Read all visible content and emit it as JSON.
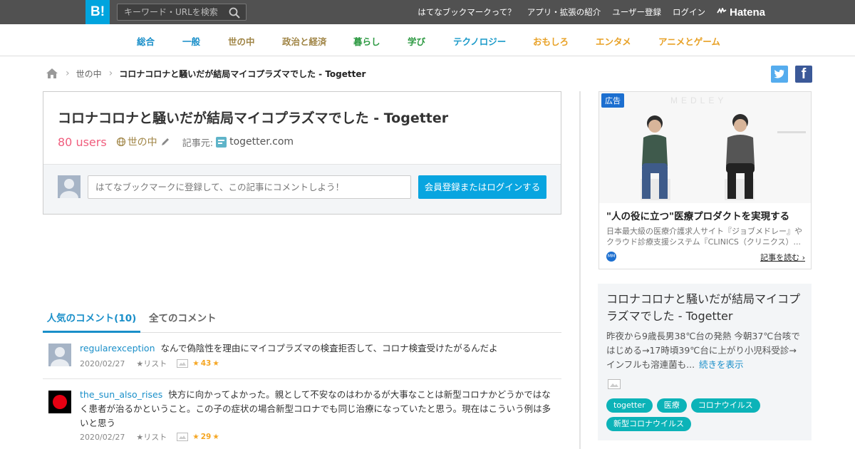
{
  "header": {
    "logo_text": "B!",
    "search": {
      "placeholder": "キーワード・URLを検索",
      "icon": "search-icon"
    },
    "links": [
      "はてなブックマークって？",
      "アプリ・拡張の紹介",
      "ユーザー登録",
      "ログイン"
    ],
    "brand": "Hatena"
  },
  "categories": [
    {
      "label": "総合",
      "color": "#1a8fc9"
    },
    {
      "label": "一般",
      "color": "#1a8fc9"
    },
    {
      "label": "世の中",
      "color": "#a08546"
    },
    {
      "label": "政治と経済",
      "color": "#a08546"
    },
    {
      "label": "暮らし",
      "color": "#2e9a43"
    },
    {
      "label": "学び",
      "color": "#2e9a43"
    },
    {
      "label": "テクノロジー",
      "color": "#1a9ac9"
    },
    {
      "label": "おもしろ",
      "color": "#e8a126"
    },
    {
      "label": "エンタメ",
      "color": "#e8a126"
    },
    {
      "label": "アニメとゲーム",
      "color": "#e8a126"
    }
  ],
  "breadcrumb": {
    "home_icon": "home-icon",
    "category": "世の中",
    "current": "コロナコロナと騒いだが結局マイコプラズマでした - Togetter"
  },
  "share": {
    "twitter_icon": "twitter-icon",
    "facebook_icon": "facebook-icon"
  },
  "entry": {
    "title": "コロナコロナと騒いだが結局マイコプラズマでした - Togetter",
    "users": "80 users",
    "category": "世の中",
    "source_label": "記事元:",
    "source": "togetter.com",
    "comment_placeholder": "はてなブックマークに登録して、この記事にコメントしよう！",
    "login_button": "会員登録またはログインする"
  },
  "tabs": {
    "popular": "人気のコメント(10)",
    "all": "全てのコメント"
  },
  "comments": [
    {
      "user": "regularexception",
      "text": "なんで偽陰性を理由にマイコプラズマの検査拒否して、コロナ検査受けたがるんだよ",
      "date": "2020/02/27",
      "list": "リスト",
      "stars": "43"
    },
    {
      "user": "the_sun_also_rises",
      "text": "快方に向かってよかった。親として不安なのはわかるが大事なことは新型コロナかどうかではなく患者が治るかということ。この子の症状の場合新型コロナでも同じ治療になっていたと思う。現在はこういう例は多いと思う",
      "date": "2020/02/27",
      "list": "リスト",
      "stars": "29"
    }
  ],
  "ad": {
    "badge": "広告",
    "title": "\"人の役に立つ\"医療プロダクトを実現する",
    "desc_lines": [
      "日本最大級の医療介護求人サイト『ジョブメドレー』や",
      "クラウド診療支援システム『CLINICS（クリニクス）..."
    ],
    "link": "記事を読む"
  },
  "summary": {
    "title": "コロナコロナと騒いだが結局マイコプラズマでした - Togetter",
    "text": "昨夜から9歳長男38℃台の発熱 今朝37℃台咳ではじめる→17時頃39℃台に上がり小児科受診→インフルも溶連菌も...",
    "more": "続きを表示",
    "tags": [
      "togetter",
      "医療",
      "コロナウイルス",
      "新型コロナウイルス"
    ]
  }
}
